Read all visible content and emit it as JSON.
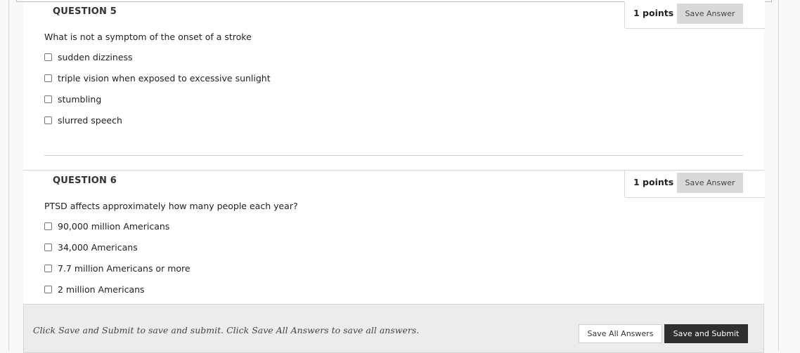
{
  "questions": [
    {
      "title": "QUESTION 5",
      "points": "1 points",
      "save_label": "Save Answer",
      "text": "What is not a symptom of the onset of a stroke",
      "choices": [
        {
          "label": "sudden dizziness",
          "checked": false
        },
        {
          "label": "triple vision when exposed to excessive sunlight",
          "checked": false
        },
        {
          "label": "stumbling",
          "checked": false
        },
        {
          "label": "slurred speech",
          "checked": false
        }
      ]
    },
    {
      "title": "QUESTION 6",
      "points": "1 points",
      "save_label": "Save Answer",
      "text": "PTSD affects approximately how many people each year?",
      "choices": [
        {
          "label": "90,000 million Americans",
          "checked": false
        },
        {
          "label": "34,000 Americans",
          "checked": false
        },
        {
          "label": "7.7 million Americans or more",
          "checked": false
        },
        {
          "label": "2 million Americans",
          "checked": false
        }
      ]
    }
  ],
  "footer": {
    "instructions": "Click Save and Submit to save and submit. Click Save All Answers to save all answers.",
    "save_all_label": "Save All Answers",
    "submit_label": "Save and Submit"
  },
  "colors": {
    "submit_bg": "#2f2f2f",
    "save_answer_bg": "#d9d9d9",
    "footer_bg": "#ececec"
  }
}
